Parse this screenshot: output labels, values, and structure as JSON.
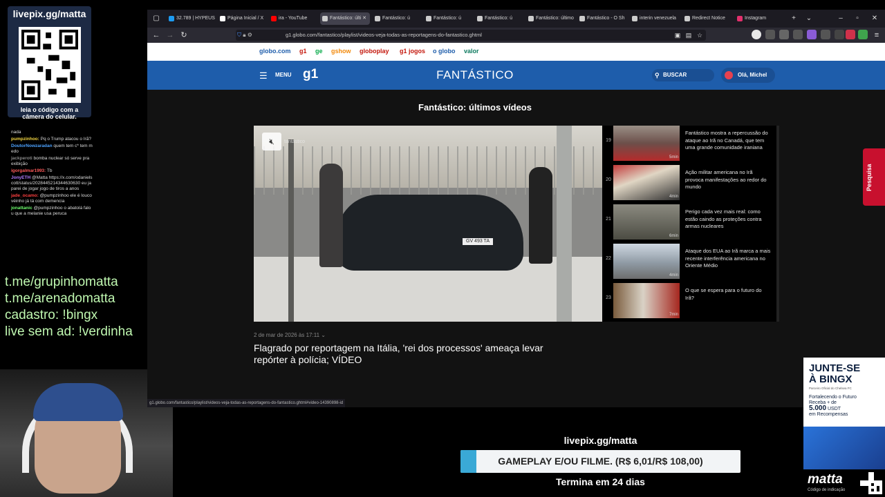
{
  "overlay": {
    "qr_title": "livepix.gg/matta",
    "qr_caption": "leia o código com a câmera do celular.",
    "chat": [
      {
        "name": "",
        "text": "nada"
      },
      {
        "name": "pumpzinhoo:",
        "text": "Pq o Trump atacou o Irã?"
      },
      {
        "name": "DoutorNowzaradan",
        "text": "quem tem c* tem medo"
      },
      {
        "name": "jackperoti",
        "text": "bomba nuclear só serve pra exibição"
      },
      {
        "name": "igorgalmar1993:",
        "text": "Tb"
      },
      {
        "name": "JonyETH",
        "text": "@Matta https://x.com/odanielscott/status/2028445214344630630 eu ja parei de jogar jogo de tiros a anos"
      },
      {
        "name": "jade_ocamo:",
        "text": "@pumpzinhoo ele é louco véinho já tá com demencia"
      },
      {
        "name": "jonattanic",
        "text": "@pumpzinhoo o abatolá falou que a melanie usa peruca"
      }
    ],
    "links": [
      "t.me/grupinhomatta",
      "t.me/arenadomatta",
      "cadastro: !bingx",
      "live sem ad: !verdinha"
    ]
  },
  "browser": {
    "tabs": [
      {
        "label": "32.789 | HYPEUS",
        "color": "#1d9bf0"
      },
      {
        "label": "Página Inicial / X",
        "color": "#ffffff"
      },
      {
        "label": "ira - YouTube",
        "color": "#ff0000"
      },
      {
        "label": "Fantástico: últi",
        "color": "#cccccc"
      },
      {
        "label": "Fantástico: ú",
        "color": "#cccccc"
      },
      {
        "label": "Fantástico: ú",
        "color": "#cccccc"
      },
      {
        "label": "Fantástico: ú",
        "color": "#cccccc"
      },
      {
        "label": "Fantástico: último",
        "color": "#cccccc"
      },
      {
        "label": "Fantástico - O Sh",
        "color": "#cccccc"
      },
      {
        "label": "interin venezuela",
        "color": "#cccccc"
      },
      {
        "label": "Redirect Notice",
        "color": "#cccccc"
      },
      {
        "label": "Instagram",
        "color": "#e1306c"
      }
    ],
    "url": "g1.globo.com/fantastico/playlist/videos-veja-todas-as-reportagens-do-fantastico.ghtml",
    "status_url": "g1.globo.com/fantastico/playlist/videos-veja-todas-as-reportagens-do-fantastico.ghtml#video-14390898-id"
  },
  "page": {
    "globo_links": [
      {
        "label": "globo.com",
        "color": "#1e5dab"
      },
      {
        "label": "g1",
        "color": "#c4170c"
      },
      {
        "label": "ge",
        "color": "#06aa48"
      },
      {
        "label": "gshow",
        "color": "#f2890a"
      },
      {
        "label": "globoplay",
        "color": "#c4170c"
      },
      {
        "label": "g1 jogos",
        "color": "#c4170c"
      },
      {
        "label": "o globo",
        "color": "#1e5dab"
      },
      {
        "label": "valor",
        "color": "#0d7a5f"
      }
    ],
    "menu_label": "MENU",
    "logo": "g1",
    "brand": "FANTÁSTICO",
    "search_label": "BUSCAR",
    "user_label": "Olá, Michel",
    "section_title": "Fantástico: últimos vídeos",
    "player": {
      "plate": "GV 493 TA",
      "watermark": "fantástico"
    },
    "playlist": [
      {
        "num": "19",
        "title": "Fantástico mostra a repercussão do ataque ao Irã no Canadá, que tem uma grande comunidade iraniana",
        "duration": "5min"
      },
      {
        "num": "20",
        "title": "Ação militar americana no Irã provoca manifestações ao redor do mundo",
        "duration": "4min"
      },
      {
        "num": "21",
        "title": "Perigo cada vez mais real: como estão caindo as proteções contra armas nucleares",
        "duration": "6min"
      },
      {
        "num": "22",
        "title": "Ataque dos EUA ao Irã marca a mais recente interferência americana no Oriente Médio",
        "duration": "4min"
      },
      {
        "num": "23",
        "title": "O que se espera para o futuro do Irã?",
        "duration": "7min"
      }
    ],
    "video_date": "2 de mar de 2026 às 17:11",
    "video_title": "Flagrado por reportagem na Itália, 'rei dos processos' ameaça levar repórter à polícia; VÍDEO",
    "side_tab": "Pesquisa"
  },
  "donation": {
    "url": "livepix.gg/matta",
    "goal_label": "GAMEPLAY E/OU FILME. (R$ 6,01/R$ 108,00)",
    "progress": 0.056,
    "ends": "Termina em 24 dias"
  },
  "ad": {
    "title_line1": "JUNTE-SE",
    "title_line2": "À BINGX",
    "subtitle": "Parceiro Oficial do Chelsea FC",
    "text1": "Fortalecendo o Futuro",
    "text2": "Receba + de",
    "amount": "5.000",
    "currency": "USDT",
    "text3": "em Recompensas",
    "logo": "matta",
    "code_label": "Código de indicação"
  }
}
